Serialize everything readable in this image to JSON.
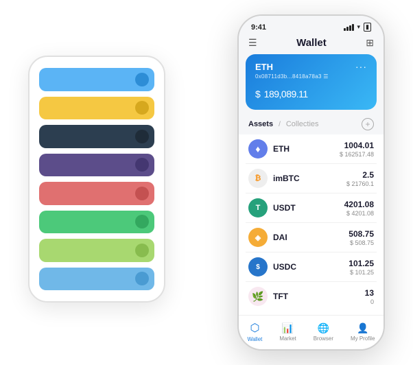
{
  "back_phone": {
    "cards": [
      {
        "color": "card-blue",
        "dot_color": "#1a7cc9"
      },
      {
        "color": "card-yellow",
        "dot_color": "#c99a10"
      },
      {
        "color": "card-dark",
        "dot_color": "#1a252f"
      },
      {
        "color": "card-purple",
        "dot_color": "#3a2d66"
      },
      {
        "color": "card-red",
        "dot_color": "#b84444"
      },
      {
        "color": "card-green",
        "dot_color": "#2a9a54"
      },
      {
        "color": "card-lime",
        "dot_color": "#7ab040"
      },
      {
        "color": "card-lightblue",
        "dot_color": "#3a8fc9"
      }
    ]
  },
  "status_bar": {
    "time": "9:41"
  },
  "header": {
    "title": "Wallet"
  },
  "eth_card": {
    "label": "ETH",
    "address": "0x08711d3b...8418a78a3  ☰",
    "currency": "$",
    "amount": " 189,089.11"
  },
  "assets": {
    "tab_active": "Assets",
    "separator": "/",
    "tab_inactive": "Collecties",
    "add_icon": "+"
  },
  "coins": [
    {
      "name": "ETH",
      "amount": "1004.01",
      "value": "$ 162517.48",
      "icon_label": "♦",
      "icon_class": "eth-icon"
    },
    {
      "name": "imBTC",
      "amount": "2.5",
      "value": "$ 21760.1",
      "icon_label": "₿",
      "icon_class": "imbtc-icon"
    },
    {
      "name": "USDT",
      "amount": "4201.08",
      "value": "$ 4201.08",
      "icon_label": "T",
      "icon_class": "usdt-icon"
    },
    {
      "name": "DAI",
      "amount": "508.75",
      "value": "$ 508.75",
      "icon_label": "D",
      "icon_class": "dai-icon"
    },
    {
      "name": "USDC",
      "amount": "101.25",
      "value": "$ 101.25",
      "icon_label": "$",
      "icon_class": "usdc-icon"
    },
    {
      "name": "TFT",
      "amount": "13",
      "value": "0",
      "icon_label": "🌿",
      "icon_class": "tft-icon"
    }
  ],
  "bottom_nav": [
    {
      "label": "Wallet",
      "icon": "⬡",
      "active": true
    },
    {
      "label": "Market",
      "icon": "📈",
      "active": false
    },
    {
      "label": "Browser",
      "icon": "👤",
      "active": false
    },
    {
      "label": "My Profile",
      "icon": "👤",
      "active": false
    }
  ]
}
